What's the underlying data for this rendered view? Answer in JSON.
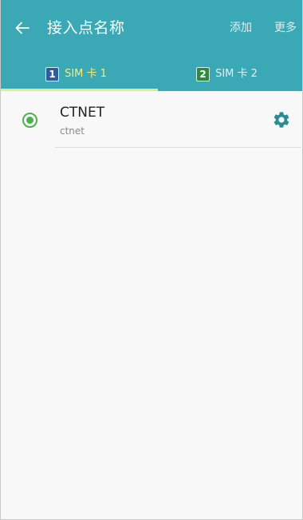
{
  "appbar": {
    "back_icon": "arrow-left-icon",
    "title": "接入点名称",
    "actions": {
      "add_label": "添加",
      "more_label": "更多"
    }
  },
  "tabs": [
    {
      "badge": "1",
      "label": "SIM 卡 1",
      "selected": true,
      "badge_color": "#2f5d9b"
    },
    {
      "badge": "2",
      "label": "SIM 卡 2",
      "selected": false,
      "badge_color": "#2e8b3e"
    }
  ],
  "apn_list": [
    {
      "name": "CTNET",
      "apn": "ctnet",
      "selected": true,
      "settings_icon": "gear-icon"
    }
  ],
  "colors": {
    "appbar": "#3aa8b5",
    "tab_indicator": "#e5e98a",
    "selected_tab_text": "#f2ef7c",
    "radio_selected": "#4caf50",
    "gear": "#2a8c97"
  }
}
